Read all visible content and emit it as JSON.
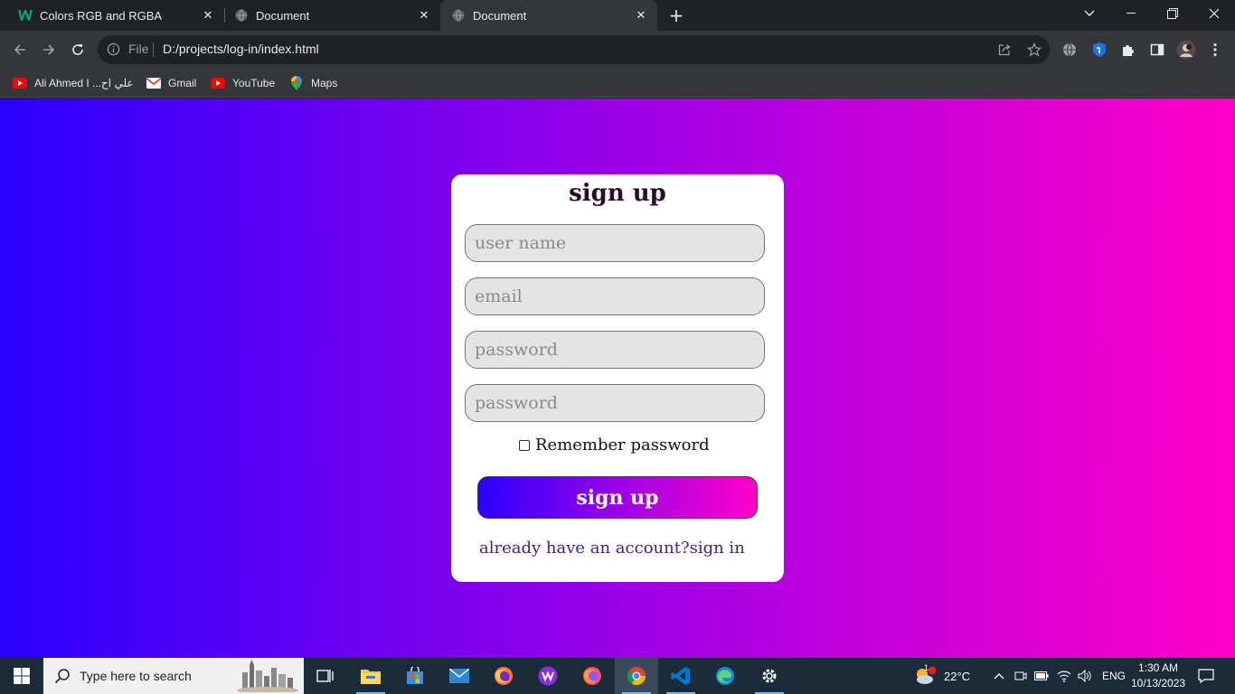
{
  "browser": {
    "tabs": [
      {
        "title": "Colors RGB and RGBA",
        "icon": "w3schools-icon"
      },
      {
        "title": "Document",
        "icon": "globe-icon"
      },
      {
        "title": "Document",
        "icon": "globe-icon",
        "active": true
      }
    ],
    "url_scheme_label": "File",
    "url": "D:/projects/log-in/index.html",
    "bookmarks": [
      {
        "label": "Ali Ahmed I ...علي اح",
        "icon": "youtube-icon"
      },
      {
        "label": "Gmail",
        "icon": "gmail-icon"
      },
      {
        "label": "YouTube",
        "icon": "youtube-icon"
      },
      {
        "label": "Maps",
        "icon": "maps-icon"
      }
    ]
  },
  "page": {
    "gradient_colors": [
      "#2a00ff",
      "#9b00e8",
      "#ff00c8"
    ],
    "form": {
      "title": "sign up",
      "username_placeholder": "user name",
      "email_placeholder": "email",
      "password_placeholder": "password",
      "confirm_password_placeholder": "password",
      "remember_label": "Remember password",
      "remember_checked": false,
      "submit_label": "sign up",
      "signin_link": "already have an account?sign in"
    }
  },
  "taskbar": {
    "search_placeholder": "Type here to search",
    "weather": "22°C",
    "weather_badge": "1",
    "language": "ENG",
    "time": "1:30 AM",
    "date": "10/13/2023"
  }
}
